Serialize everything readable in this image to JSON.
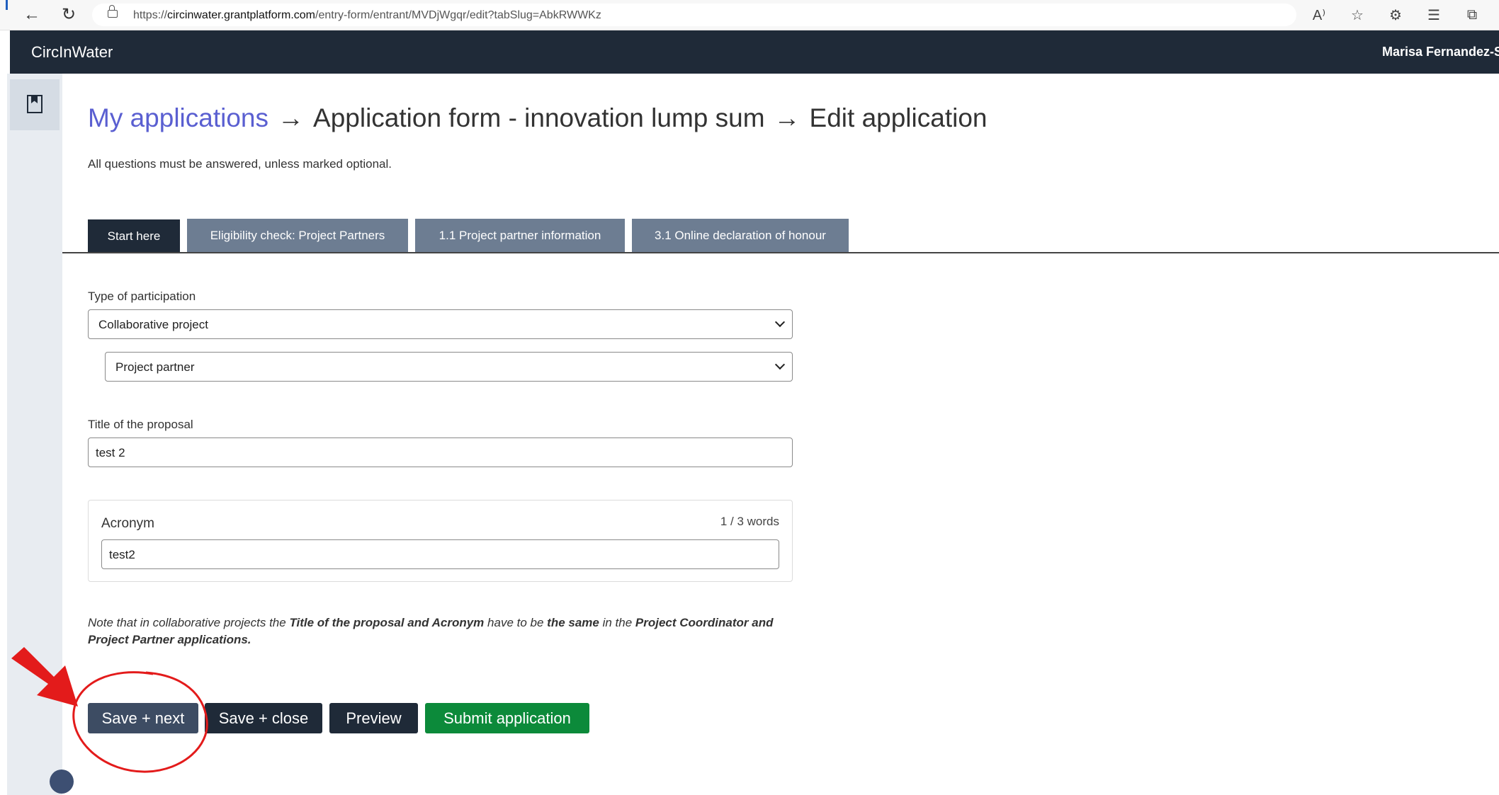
{
  "browser": {
    "url_prefix": "https://",
    "url_host": "circinwater.grantplatform.com",
    "url_path": "/entry-form/entrant/MVDjWgqr/edit?tabSlug=AbkRWWKz"
  },
  "header": {
    "app_name": "CircInWater",
    "user_name": "Marisa Fernandez-So"
  },
  "breadcrumb": {
    "link": "My applications",
    "arrow": "→",
    "form": "Application form - innovation lump sum",
    "current": "Edit application"
  },
  "intro": "All questions must be answered, unless marked optional.",
  "tabs": [
    {
      "label": "Start here",
      "active": true
    },
    {
      "label": "Eligibility check: Project Partners"
    },
    {
      "label": "1.1 Project partner information"
    },
    {
      "label": "3.1 Online declaration of honour"
    }
  ],
  "form": {
    "participation_label": "Type of participation",
    "participation_value": "Collaborative project",
    "role_value": "Project partner",
    "title_label": "Title of the proposal",
    "title_value": "test 2",
    "acronym_label": "Acronym",
    "acronym_wordcount": "1 / 3 words",
    "acronym_value": "test2"
  },
  "note": {
    "p1": "Note that in collaborative projects the ",
    "b1": "Title of the proposal and Acronym",
    "p2": " have to be ",
    "b2": "the same",
    "p3": " in the ",
    "b3": "Project Coordinator and Project Partner applications."
  },
  "buttons": {
    "save_next": "Save + next",
    "save_close": "Save + close",
    "preview": "Preview",
    "submit": "Submit application"
  },
  "colors": {
    "header_bg": "#1f2a38",
    "link": "#5a5fd1",
    "tab_inactive": "#6d7d92",
    "submit": "#0c8a3a",
    "annotation": "#e31b1b"
  }
}
